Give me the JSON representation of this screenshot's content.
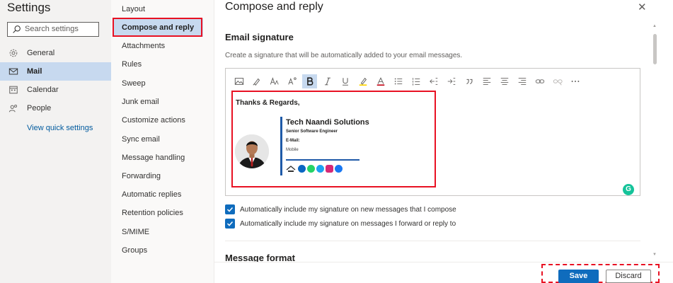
{
  "left_nav": {
    "title": "Settings",
    "search_placeholder": "Search settings",
    "items": [
      {
        "label": "General",
        "icon": "gear-icon"
      },
      {
        "label": "Mail",
        "icon": "mail-icon",
        "active": true
      },
      {
        "label": "Calendar",
        "icon": "calendar-icon"
      },
      {
        "label": "People",
        "icon": "people-icon"
      }
    ],
    "view_quick_settings": "View quick settings"
  },
  "mail_nav": {
    "items": [
      "Layout",
      "Compose and reply",
      "Attachments",
      "Rules",
      "Sweep",
      "Junk email",
      "Customize actions",
      "Sync email",
      "Message handling",
      "Forwarding",
      "Automatic replies",
      "Retention policies",
      "S/MIME",
      "Groups"
    ],
    "active": "Compose and reply"
  },
  "main": {
    "title": "Compose and reply",
    "close_glyph": "✕",
    "email_signature": {
      "title": "Email signature",
      "description": "Create a signature that will be automatically added to your email messages."
    },
    "signature": {
      "regards": "Thanks & Regards,",
      "company": "Tech Naandi Solutions",
      "role": "Senior Software Engineer",
      "email_label": "E-Mail:",
      "mobile_label": "Mobile"
    },
    "checkboxes": [
      {
        "label": "Automatically include my signature on new messages that I compose",
        "checked": true
      },
      {
        "label": "Automatically include my signature on messages I forward or reply to",
        "checked": true
      }
    ],
    "message_format_title": "Message format"
  },
  "footer": {
    "save_label": "Save",
    "discard_label": "Discard"
  },
  "colors": {
    "accent": "#0f6cbd",
    "highlight": "#e81123",
    "active_bg": "#c7d9ef"
  }
}
